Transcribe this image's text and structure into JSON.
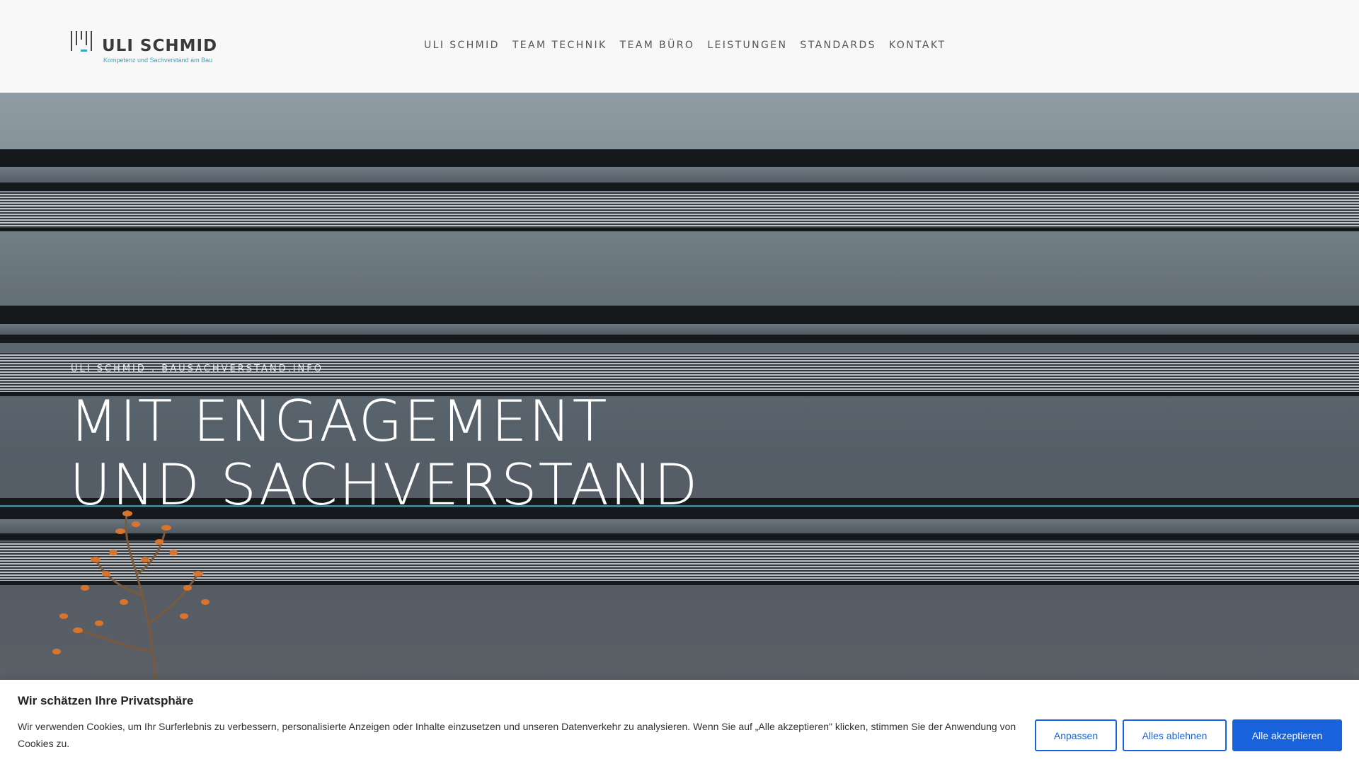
{
  "header": {
    "logo": {
      "name": "ULI SCHMID",
      "tagline": "Kompetenz und Sachverstand am Bau"
    },
    "nav": [
      {
        "label": "ULI SCHMID"
      },
      {
        "label": "TEAM TECHNIK"
      },
      {
        "label": "TEAM BÜRO"
      },
      {
        "label": "LEISTUNGEN"
      },
      {
        "label": "STANDARDS"
      },
      {
        "label": "KONTAKT"
      }
    ]
  },
  "hero": {
    "subtitle": "ULI SCHMID . BAUSACHVERSTAND.INFO",
    "title_line1": "MIT ENGAGEMENT",
    "title_line2": "UND SACHVERSTAND"
  },
  "cookie": {
    "title": "Wir schätzen Ihre Privatsphäre",
    "text": "Wir verwenden Cookies, um Ihr Surferlebnis zu verbessern, personalisierte Anzeigen oder Inhalte einzusetzen und unseren Datenverkehr zu analysieren. Wenn Sie auf „Alle akzeptieren\" klicken, stimmen Sie der Anwendung von Cookies zu.",
    "btn_customize": "Anpassen",
    "btn_reject": "Alles ablehnen",
    "btn_accept": "Alle akzeptieren"
  },
  "colors": {
    "accent": "#1863dc",
    "brand_teal": "#3aa6b9"
  }
}
